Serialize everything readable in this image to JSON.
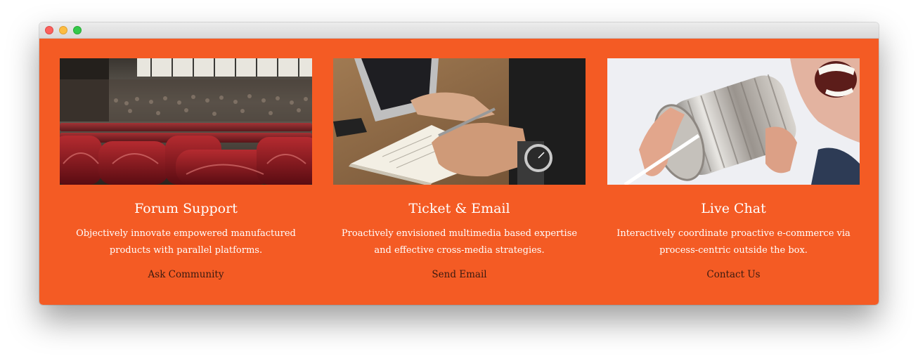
{
  "window": {
    "controls": [
      "close-icon",
      "minimize-icon",
      "zoom-icon"
    ]
  },
  "theme": {
    "background": "#f45b24",
    "text": "#ffffff",
    "link": "#3b1a10"
  },
  "cards": [
    {
      "image": "auditorium-seats-photo",
      "title": "Forum Support",
      "description": "Objectively innovate empowered manufactured products with parallel platforms.",
      "link": "Ask Community"
    },
    {
      "image": "writing-notebook-photo",
      "title": "Ticket & Email",
      "description": "Proactively envisioned multimedia based expertise and effective cross-media strategies.",
      "link": "Send Email"
    },
    {
      "image": "tin-can-phone-photo",
      "title": "Live Chat",
      "description": "Interactively coordinate proactive e-commerce via process-centric outside the box.",
      "link": "Contact Us"
    }
  ]
}
